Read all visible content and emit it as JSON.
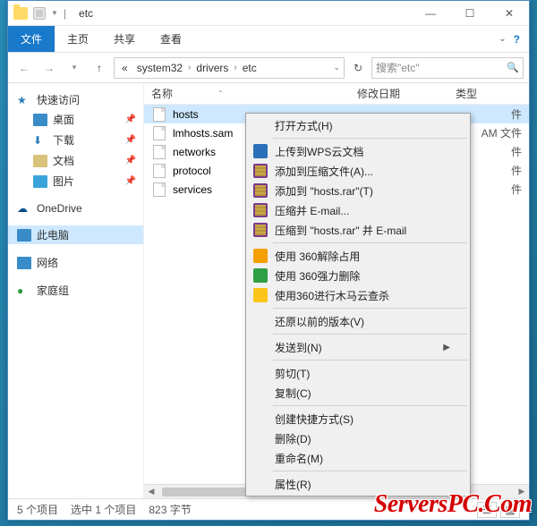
{
  "window": {
    "title": "etc",
    "minimize": "—",
    "maximize": "☐",
    "close": "✕"
  },
  "tabs": {
    "file": "文件",
    "home": "主页",
    "share": "共享",
    "view": "查看"
  },
  "nav": {
    "back": "←",
    "forward": "→",
    "recent": "▾",
    "up": "↑",
    "refresh": "↻"
  },
  "breadcrumb": {
    "prefix": "«",
    "parts": [
      "system32",
      "drivers",
      "etc"
    ],
    "caret": "›"
  },
  "search": {
    "placeholder": "搜索\"etc\"",
    "icon": "🔍"
  },
  "sidebar": {
    "quick": "快速访问",
    "items": [
      {
        "icon": "desktop",
        "label": "桌面",
        "pinned": true
      },
      {
        "icon": "download",
        "label": "下载",
        "pinned": true
      },
      {
        "icon": "doc",
        "label": "文档",
        "pinned": true
      },
      {
        "icon": "pic",
        "label": "图片",
        "pinned": true
      }
    ],
    "onedrive": "OneDrive",
    "thispc": "此电脑",
    "network": "网络",
    "homegroup": "家庭组"
  },
  "columns": {
    "name": "名称",
    "date": "修改日期",
    "type": "类型"
  },
  "files": [
    {
      "name": "hosts",
      "type": "件",
      "selected": true
    },
    {
      "name": "lmhosts.sam",
      "type": "AM 文件"
    },
    {
      "name": "networks",
      "type": "件"
    },
    {
      "name": "protocol",
      "type": "件"
    },
    {
      "name": "services",
      "type": "件"
    }
  ],
  "status": {
    "count": "5 个项目",
    "selection": "选中 1 个项目",
    "size": "823 字节"
  },
  "context_menu": [
    {
      "type": "item",
      "label": "打开方式(H)"
    },
    {
      "type": "sep"
    },
    {
      "type": "item",
      "icon": "wps",
      "label": "上传到WPS云文档"
    },
    {
      "type": "item",
      "icon": "rar",
      "label": "添加到压缩文件(A)..."
    },
    {
      "type": "item",
      "icon": "rar",
      "label": "添加到 \"hosts.rar\"(T)"
    },
    {
      "type": "item",
      "icon": "rar",
      "label": "压缩并 E-mail..."
    },
    {
      "type": "item",
      "icon": "rar",
      "label": "压缩到 \"hosts.rar\" 并 E-mail"
    },
    {
      "type": "sep"
    },
    {
      "type": "item",
      "icon": "s360o",
      "label": "使用 360解除占用"
    },
    {
      "type": "item",
      "icon": "s360g",
      "label": "使用 360强力删除"
    },
    {
      "type": "item",
      "icon": "s360y",
      "label": "使用360进行木马云查杀"
    },
    {
      "type": "sep"
    },
    {
      "type": "item",
      "label": "还原以前的版本(V)"
    },
    {
      "type": "sep"
    },
    {
      "type": "item",
      "label": "发送到(N)",
      "submenu": true
    },
    {
      "type": "sep"
    },
    {
      "type": "item",
      "label": "剪切(T)"
    },
    {
      "type": "item",
      "label": "复制(C)"
    },
    {
      "type": "sep"
    },
    {
      "type": "item",
      "label": "创建快捷方式(S)"
    },
    {
      "type": "item",
      "label": "删除(D)"
    },
    {
      "type": "item",
      "label": "重命名(M)"
    },
    {
      "type": "sep"
    },
    {
      "type": "item",
      "label": "属性(R)"
    }
  ],
  "watermark": "ServersPC.Com"
}
